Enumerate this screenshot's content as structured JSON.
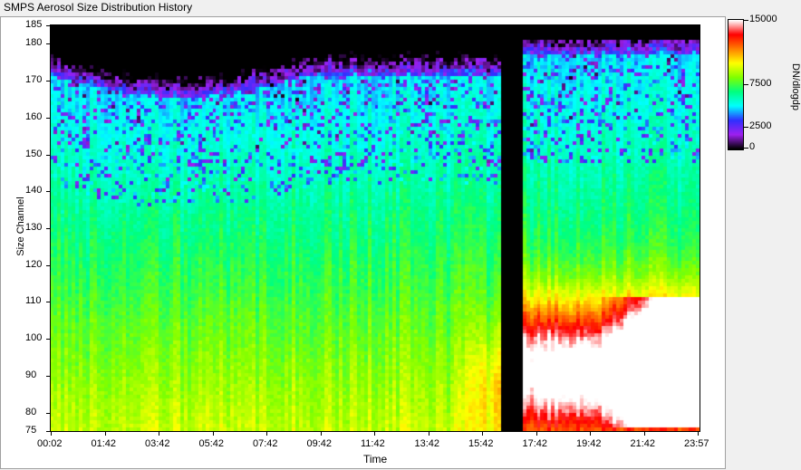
{
  "window": {
    "title": "SMPS Aerosol Size Distribution History"
  },
  "chart_data": {
    "type": "heatmap",
    "title": "",
    "xlabel": "Time",
    "ylabel": "Size Channel",
    "colorbar_label": "DN/dlogdp",
    "colorbar_ticks": [
      "15000",
      "7500",
      "2500",
      "0"
    ],
    "colorbar_values": [
      15000,
      7500,
      2500,
      0
    ],
    "colorscale": [
      "#000000",
      "#a020f0",
      "#3030ff",
      "#00ffff",
      "#00ff80",
      "#80ff00",
      "#ffff00",
      "#ff8000",
      "#ff0000",
      "#ffffff"
    ],
    "x_ticks": [
      "00:02",
      "01:42",
      "03:42",
      "05:42",
      "07:42",
      "09:42",
      "11:42",
      "13:42",
      "15:42",
      "17:42",
      "19:42",
      "21:42",
      "23:57"
    ],
    "y_ticks": [
      "185",
      "180",
      "170",
      "160",
      "150",
      "140",
      "130",
      "120",
      "110",
      "100",
      "90",
      "80",
      "75"
    ],
    "y_tick_values": [
      185,
      180,
      170,
      160,
      150,
      140,
      130,
      120,
      110,
      100,
      90,
      80,
      75
    ],
    "ylim": [
      75,
      185
    ],
    "data_gap": {
      "start": "16:42",
      "end": "17:32"
    }
  }
}
